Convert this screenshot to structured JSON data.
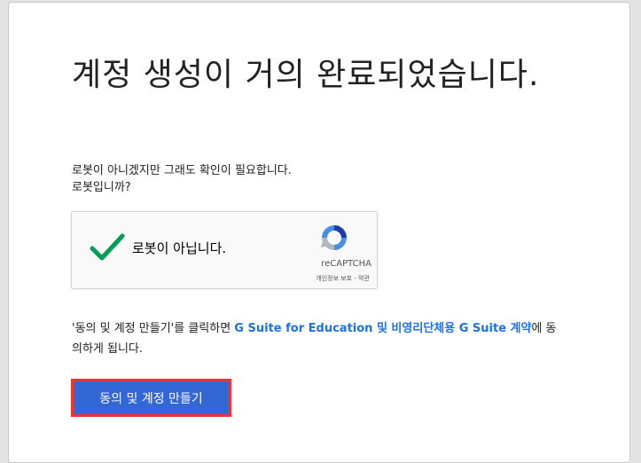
{
  "page": {
    "title": "계정 생성이 거의 완료되었습니다."
  },
  "robot_check": {
    "line1": "로봇이 아니겠지만 그래도 확인이 필요합니다.",
    "line2": "로봇입니까?"
  },
  "captcha": {
    "label": "로봇이 아닙니다.",
    "checked": true,
    "brand": "reCAPTCHA",
    "privacy_link": "개인정보 보호",
    "separator": " - ",
    "terms_link": "약관",
    "check_color": "#009e55"
  },
  "terms": {
    "prefix": "'동의 및 계정 만들기'를 클릭하면 ",
    "link_text": "G Suite for Education 및 비영리단체용 G Suite 계약",
    "suffix": "에 동의하게 됩니다.",
    "link_color": "#1a73e8"
  },
  "actions": {
    "agree_button_label": "동의 및 계정 만들기",
    "button_color": "#3367d6",
    "highlight_color": "#e53935"
  }
}
